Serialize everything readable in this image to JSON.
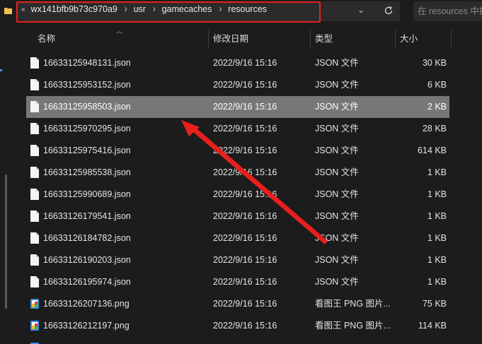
{
  "address_bar": {
    "overflow": "«",
    "crumbs": [
      "wx141bfb9b73c970a9",
      "usr",
      "gamecaches",
      "resources"
    ],
    "search_placeholder": "在 resources 中搜"
  },
  "columns": {
    "name": "名称",
    "date": "修改日期",
    "type": "类型",
    "size": "大小"
  },
  "files": [
    {
      "name": "16633125948131.json",
      "date": "2022/9/16 15:16",
      "type": "JSON 文件",
      "size": "30 KB",
      "icon": "json-file-icon",
      "selected": false
    },
    {
      "name": "16633125953152.json",
      "date": "2022/9/16 15:16",
      "type": "JSON 文件",
      "size": "6 KB",
      "icon": "json-file-icon",
      "selected": false
    },
    {
      "name": "16633125958503.json",
      "date": "2022/9/16 15:16",
      "type": "JSON 文件",
      "size": "2 KB",
      "icon": "json-file-icon",
      "selected": true
    },
    {
      "name": "16633125970295.json",
      "date": "2022/9/16 15:16",
      "type": "JSON 文件",
      "size": "28 KB",
      "icon": "json-file-icon",
      "selected": false
    },
    {
      "name": "16633125975416.json",
      "date": "2022/9/16 15:16",
      "type": "JSON 文件",
      "size": "614 KB",
      "icon": "json-file-icon",
      "selected": false
    },
    {
      "name": "16633125985538.json",
      "date": "2022/9/16 15:16",
      "type": "JSON 文件",
      "size": "1 KB",
      "icon": "json-file-icon",
      "selected": false
    },
    {
      "name": "16633125990689.json",
      "date": "2022/9/16 15:16",
      "type": "JSON 文件",
      "size": "1 KB",
      "icon": "json-file-icon",
      "selected": false
    },
    {
      "name": "16633126179541.json",
      "date": "2022/9/16 15:16",
      "type": "JSON 文件",
      "size": "1 KB",
      "icon": "json-file-icon",
      "selected": false
    },
    {
      "name": "16633126184782.json",
      "date": "2022/9/16 15:16",
      "type": "JSON 文件",
      "size": "1 KB",
      "icon": "json-file-icon",
      "selected": false
    },
    {
      "name": "16633126190203.json",
      "date": "2022/9/16 15:16",
      "type": "JSON 文件",
      "size": "1 KB",
      "icon": "json-file-icon",
      "selected": false
    },
    {
      "name": "16633126195974.json",
      "date": "2022/9/16 15:16",
      "type": "JSON 文件",
      "size": "1 KB",
      "icon": "json-file-icon",
      "selected": false
    },
    {
      "name": "16633126207136.png",
      "date": "2022/9/16 15:16",
      "type": "看图王 PNG 图片...",
      "size": "75 KB",
      "icon": "png-image-icon",
      "selected": false
    },
    {
      "name": "16633126212197.png",
      "date": "2022/9/16 15:16",
      "type": "看图王 PNG 图片...",
      "size": "114 KB",
      "icon": "png-image-icon",
      "selected": false
    },
    {
      "name": "",
      "date": "",
      "type": "",
      "size": "",
      "icon": "png-image-icon",
      "selected": false
    }
  ],
  "colors": {
    "annotation_red": "#e8201c",
    "selection": "#777777",
    "background": "#1c1c1c"
  }
}
